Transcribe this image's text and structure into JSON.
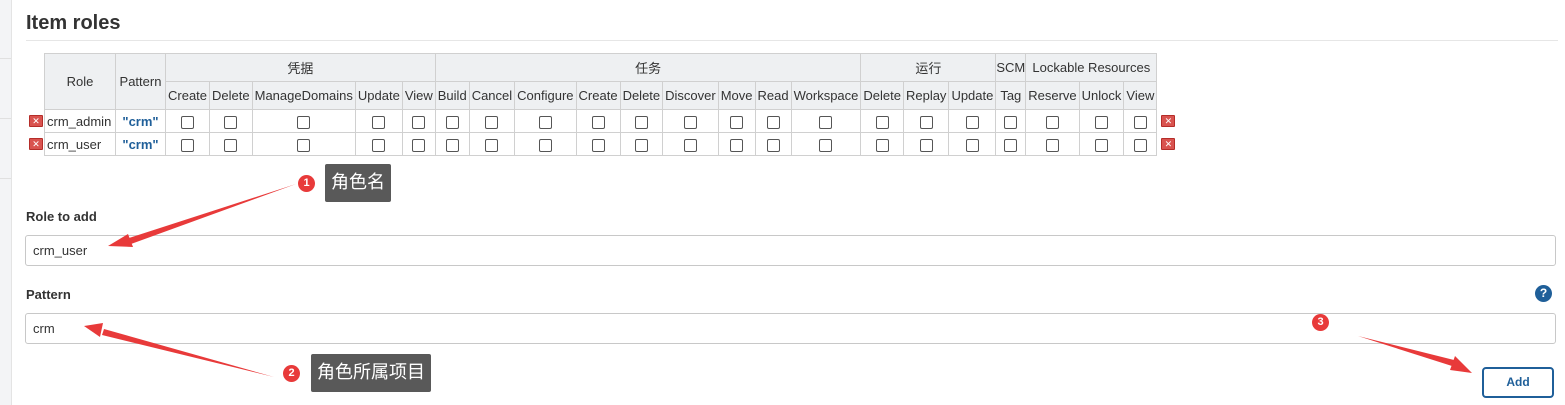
{
  "section": {
    "title": "Item roles"
  },
  "table": {
    "header": {
      "role": "Role",
      "pattern": "Pattern",
      "groups": [
        {
          "label": "凭据",
          "span": 5
        },
        {
          "label": "任务",
          "span": 9
        },
        {
          "label": "运行",
          "span": 3
        },
        {
          "label": "SCM",
          "span": 1
        },
        {
          "label": "Lockable Resources",
          "span": 3
        }
      ],
      "permissions": [
        "Create",
        "Delete",
        "ManageDomains",
        "Update",
        "View",
        "Build",
        "Cancel",
        "Configure",
        "Create",
        "Delete",
        "Discover",
        "Move",
        "Read",
        "Workspace",
        "Delete",
        "Replay",
        "Update",
        "Tag",
        "Reserve",
        "Unlock",
        "View"
      ]
    },
    "rows": [
      {
        "role": "crm_admin",
        "pattern": "\"crm\""
      },
      {
        "role": "crm_user",
        "pattern": "\"crm\""
      }
    ]
  },
  "form": {
    "role_label": "Role to add",
    "role_value": "crm_user",
    "pattern_label": "Pattern",
    "pattern_value": "crm",
    "add_button": "Add",
    "help_glyph": "?"
  },
  "annotations": [
    {
      "number": "1",
      "text": "角色名"
    },
    {
      "number": "2",
      "text": "角色所属项目"
    },
    {
      "number": "3"
    }
  ],
  "colors": {
    "accent": "#1f5f99",
    "annotation_red": "#e83a3a",
    "callout_bg": "#595959",
    "delete_red": "#d9534f"
  },
  "icons": {
    "delete": "delete-icon",
    "help": "help-icon",
    "arrow": "arrow-icon"
  }
}
